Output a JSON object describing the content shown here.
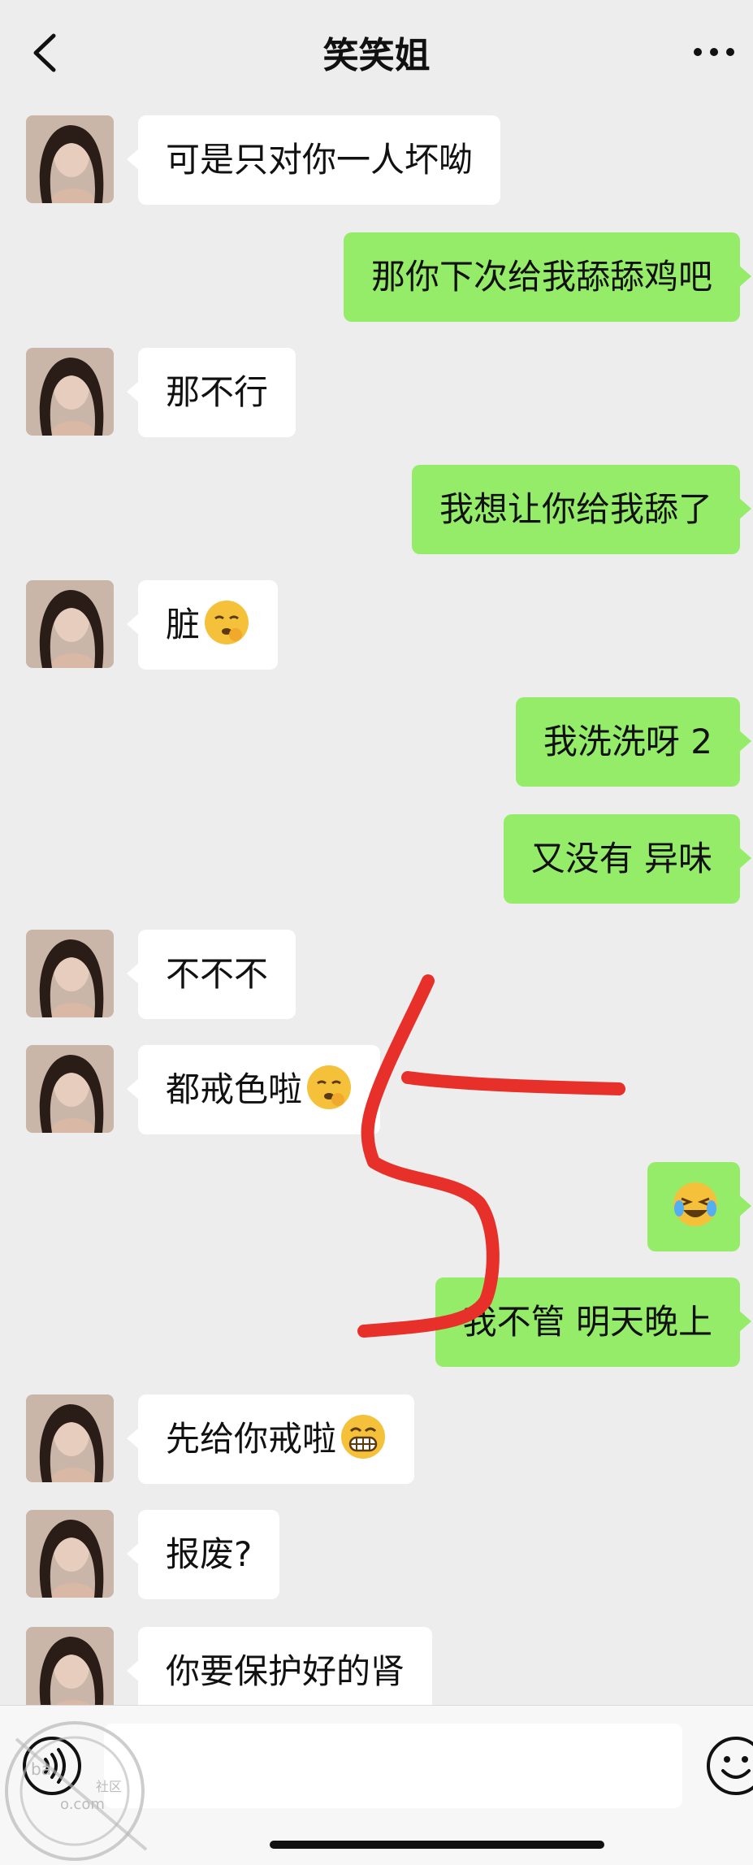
{
  "header": {
    "title": "笑笑姐"
  },
  "messages": [
    {
      "side": "in",
      "text": "可是只对你一人坏呦"
    },
    {
      "side": "out",
      "text": "那你下次给我舔舔鸡吧"
    },
    {
      "side": "in",
      "text": "那不行"
    },
    {
      "side": "out",
      "text": "我想让你给我舔了"
    },
    {
      "side": "in",
      "text": "脏",
      "emoji": "hushed-face-emoji"
    },
    {
      "side": "out",
      "text": "我洗洗呀 2"
    },
    {
      "side": "out",
      "text": "又没有 异味"
    },
    {
      "side": "in",
      "text": "不不不"
    },
    {
      "side": "in",
      "text": "都戒色啦",
      "emoji": "hushed-face-emoji"
    },
    {
      "side": "out",
      "text": "",
      "emoji": "laughing-crying-emoji"
    },
    {
      "side": "out",
      "text": "我不管 明天晚上"
    },
    {
      "side": "in",
      "text": "先给你戒啦",
      "emoji": "grinning-face-emoji"
    },
    {
      "side": "in",
      "text": "报废?"
    },
    {
      "side": "in",
      "text": "你要保护好的肾"
    }
  ],
  "input": {
    "placeholder": ""
  },
  "watermark": {
    "text1": "ba",
    "text2": "社区",
    "text3": "o.com"
  },
  "colors": {
    "background": "#ededed",
    "incoming_bubble": "#ffffff",
    "outgoing_bubble": "#95ec69",
    "annotation_stroke": "#e8302a"
  },
  "icons": {
    "back": "back-chevron-icon",
    "more": "more-dots-icon",
    "voice": "voice-icon",
    "emoji": "emoji-smiley-icon"
  }
}
